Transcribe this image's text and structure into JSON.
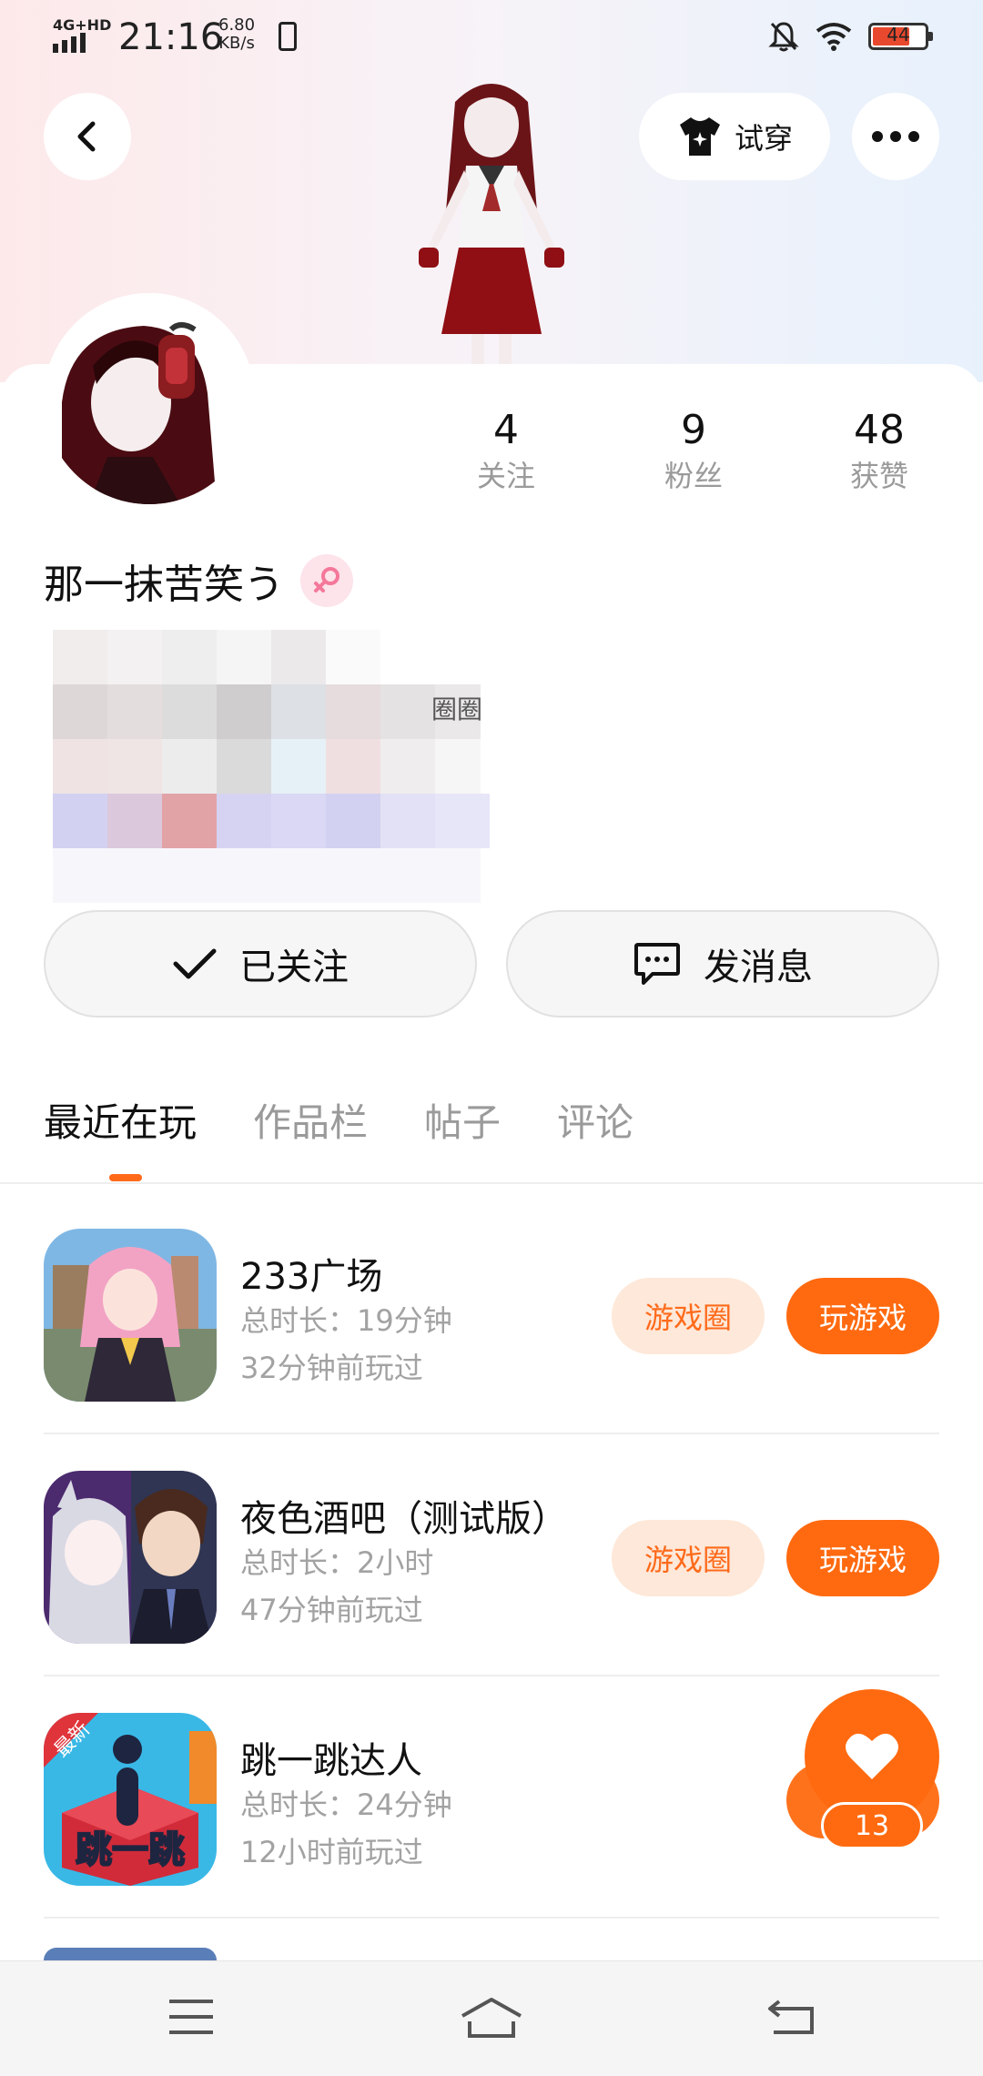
{
  "status_bar": {
    "signal": "4G+HD",
    "time": "21:16",
    "speed_value": "6.80",
    "speed_unit": "KB/s",
    "battery": "44"
  },
  "header": {
    "try_on_label": "试穿"
  },
  "profile": {
    "nickname": "那一抹苦笑う",
    "partial_text": "圈圈",
    "stats": [
      {
        "value": "4",
        "label": "关注"
      },
      {
        "value": "9",
        "label": "粉丝"
      },
      {
        "value": "48",
        "label": "获赞"
      }
    ],
    "follow_label": "已关注",
    "message_label": "发消息"
  },
  "tabs": [
    "最近在玩",
    "作品栏",
    "帖子",
    "评论"
  ],
  "games": [
    {
      "name": "233广场",
      "duration": "总时长：19分钟",
      "last_played": "32分钟前玩过",
      "circle_label": "游戏圈",
      "play_label": "玩游戏"
    },
    {
      "name": "夜色酒吧（测试版）",
      "duration": "总时长：2小时",
      "last_played": "47分钟前玩过",
      "circle_label": "游戏圈",
      "play_label": "玩游戏"
    },
    {
      "name": "跳一跳达人",
      "duration": "总时长：24分钟",
      "last_played": "12小时前玩过",
      "icon_badge": "最新",
      "icon_text": "跳一跳"
    }
  ],
  "like_fab": {
    "count": "13"
  },
  "colors": {
    "accent": "#ff6a10",
    "accent_light": "#fee8d9",
    "muted_text": "#a2a2a2"
  }
}
